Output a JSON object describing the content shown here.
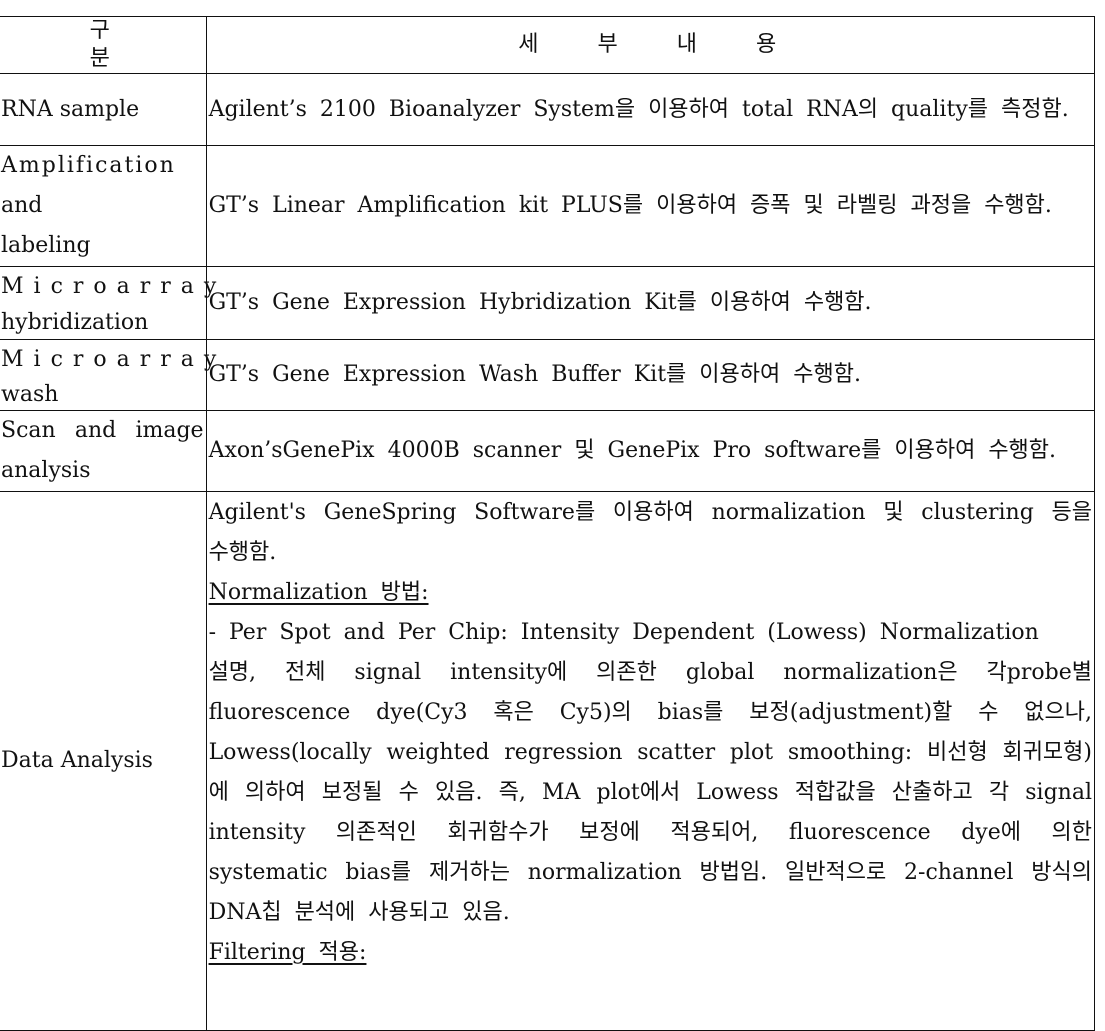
{
  "table": {
    "headers": {
      "category": "구 분",
      "detail": "세 부 내 용"
    },
    "rows": [
      {
        "category_lines": [
          "RNA sample"
        ],
        "detail_paragraphs": [
          "Agilent’s 2100 Bioanalyzer System을 이용하여 total RNA의 quality를 측정함."
        ]
      },
      {
        "category_lines": [
          "Amplification",
          "and",
          "labeling"
        ],
        "detail_paragraphs": [
          "GT’s Linear Amplification kit PLUS를 이용하여 증폭 및 라벨링 과정을 수행함."
        ]
      },
      {
        "category_lines": [
          "Microarray",
          "hybridization"
        ],
        "detail_paragraphs": [
          "GT’s Gene Expression Hybridization Kit를 이용하여 수행함."
        ]
      },
      {
        "category_lines": [
          "Microarray",
          "wash"
        ],
        "detail_paragraphs": [
          "GT’s Gene Expression Wash Buffer Kit를 이용하여 수행함."
        ]
      },
      {
        "category_lines": [
          "Scan and image",
          "analysis"
        ],
        "detail_paragraphs": [
          "Axon’sGenePix 4000B scanner 및 GenePix Pro software를 이용하여 수행함."
        ]
      },
      {
        "category_lines": [
          "Data Analysis"
        ],
        "detail_paragraphs": [
          "Agilent's GeneSpring Software를 이용하여 normalization 및 clustering 등을 수행함.",
          "Normalization 방법:",
          "- Per Spot and Per Chip: Intensity Dependent (Lowess) Normalization",
          "설명, 전체 signal intensity에 의존한 global normalization은 각probe별 fluorescence dye(Cy3 혹은 Cy5)의 bias를 보정(adjustment)할 수 없으나, Lowess(locally weighted regression scatter plot smoothing: 비선형 회귀모형)에 의하여 보정될 수 있음. 즉, MA plot에서 Lowess 적합값을 산출하고 각 signal intensity 의존적인 회귀함수가 보정에 적용되어, fluorescence dye에 의한 systematic bias를 제거하는 normalization 방법임. 일반적으로 2-channel 방식의 DNA칩 분석에 사용되고 있음.",
          "Filtering 적용:"
        ]
      }
    ]
  }
}
